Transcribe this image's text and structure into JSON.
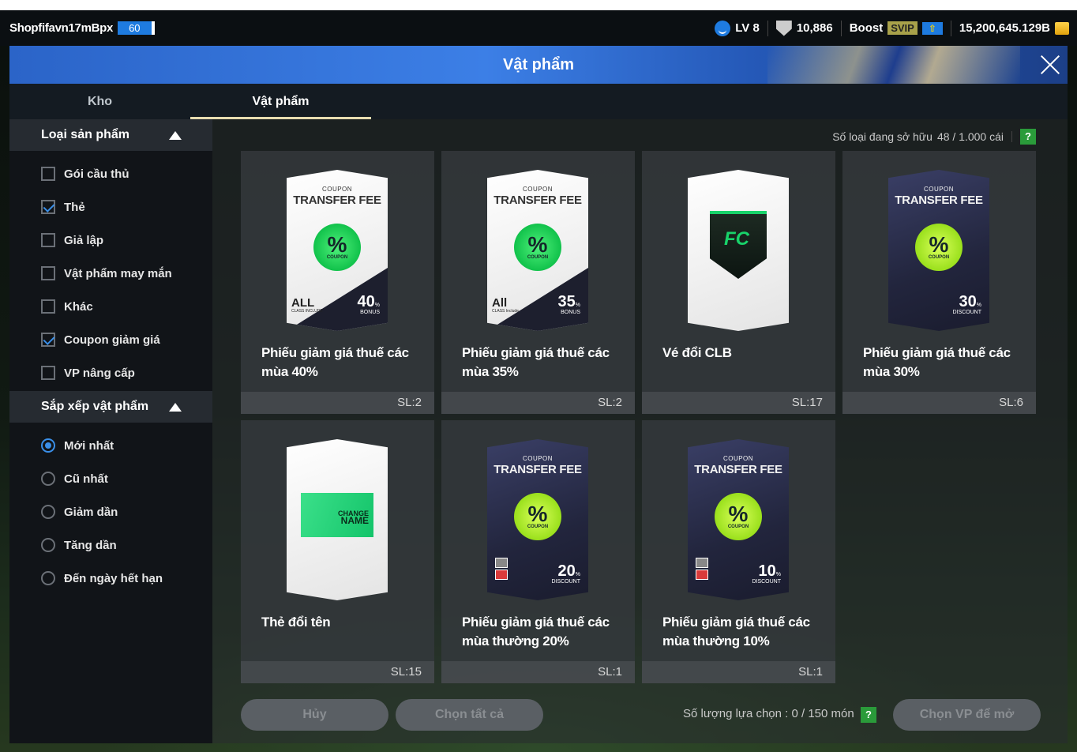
{
  "user": {
    "name": "Shopfifavn17mBpx",
    "level_badge": "60"
  },
  "status": {
    "level": "LV 8",
    "points": "10,886",
    "boost": "Boost",
    "svip": "SVIP",
    "boost_icon": "⇧",
    "balance": "15,200,645.129B"
  },
  "title": "Vật phẩm",
  "tabs": [
    {
      "label": "Kho"
    },
    {
      "label": "Vật phẩm"
    }
  ],
  "filter": {
    "header": "Loại sản phẩm",
    "options": [
      {
        "label": "Gói cầu thủ",
        "checked": false
      },
      {
        "label": "Thẻ",
        "checked": true
      },
      {
        "label": "Giả lập",
        "checked": false
      },
      {
        "label": "Vật phẩm may mắn",
        "checked": false
      },
      {
        "label": "Khác",
        "checked": false
      },
      {
        "label": "Coupon giảm giá",
        "checked": true
      },
      {
        "label": "VP nâng cấp",
        "checked": false
      }
    ]
  },
  "sort": {
    "header": "Sắp xếp vật phẩm",
    "options": [
      {
        "label": "Mới nhất",
        "selected": true
      },
      {
        "label": "Cũ nhất",
        "selected": false
      },
      {
        "label": "Giảm dần",
        "selected": false
      },
      {
        "label": "Tăng dần",
        "selected": false
      },
      {
        "label": "Đến ngày hết hạn",
        "selected": false
      }
    ]
  },
  "owned": {
    "label": "Số loại đang sở hữu",
    "value": "48 / 1.000 cái",
    "help": "?"
  },
  "items": [
    {
      "name": "Phiếu giảm giá thuế các mùa 40%",
      "qty": "SL:2",
      "coupon": "COUPON",
      "fee": "TRANSFER FEE",
      "pct": "%",
      "pct_label": "COUPON",
      "value": "40",
      "value_unit": "%",
      "value_label": "BONUS",
      "class_big": "ALL",
      "class_small": "CLASS INCLUDE"
    },
    {
      "name": "Phiếu giảm giá thuế các mùa 35%",
      "qty": "SL:2",
      "coupon": "COUPON",
      "fee": "TRANSFER FEE",
      "pct": "%",
      "pct_label": "COUPON",
      "value": "35",
      "value_unit": "%",
      "value_label": "BONUS",
      "class_big": "All",
      "class_small": "CLASS Include"
    },
    {
      "name": "Vé đổi CLB",
      "qty": "SL:17"
    },
    {
      "name": "Phiếu giảm giá thuế các mùa 30%",
      "qty": "SL:6",
      "coupon": "COUPON",
      "fee": "TRANSFER FEE",
      "pct": "%",
      "pct_label": "COUPON",
      "value": "30",
      "value_unit": "%",
      "value_label": "DISCOUNT"
    },
    {
      "name": "Thẻ đổi tên",
      "qty": "SL:15",
      "card_l1": "CHANGE",
      "card_l2": "NAME"
    },
    {
      "name": "Phiếu giảm giá thuế các mùa thường 20%",
      "qty": "SL:1",
      "coupon": "COUPON",
      "fee": "TRANSFER FEE",
      "pct": "%",
      "pct_label": "COUPON",
      "value": "20",
      "value_unit": "%",
      "value_label": "DISCOUNT"
    },
    {
      "name": "Phiếu giảm giá thuế các mùa thường 10%",
      "qty": "SL:1",
      "coupon": "COUPON",
      "fee": "TRANSFER FEE",
      "pct": "%",
      "pct_label": "COUPON",
      "value": "10",
      "value_unit": "%",
      "value_label": "DISCOUNT"
    }
  ],
  "bottom": {
    "cancel": "Hủy",
    "select_all": "Chọn tất cả",
    "selection_label": "Số lượng lựa chọn : 0 / 150 món",
    "help": "?",
    "open": "Chọn VP để mở"
  }
}
